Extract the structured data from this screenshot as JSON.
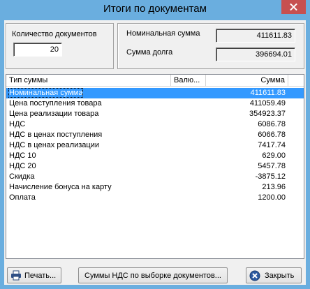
{
  "window": {
    "title": "Итоги по документам"
  },
  "count": {
    "label": "Количество документов",
    "value": "20"
  },
  "sums": {
    "nominal_label": "Номинальная сумма",
    "nominal_value": "411611.83",
    "debt_label": "Сумма долга",
    "debt_value": "396694.01"
  },
  "table": {
    "columns": [
      "Тип суммы",
      "Валю...",
      "Сумма"
    ],
    "rows": [
      {
        "type": "Номинальная сумма",
        "currency": "",
        "amount": "411611.83",
        "selected": true
      },
      {
        "type": "Цена поступления товара",
        "currency": "",
        "amount": "411059.49"
      },
      {
        "type": "Цена реализации товара",
        "currency": "",
        "amount": "354923.37"
      },
      {
        "type": "НДС",
        "currency": "",
        "amount": "6086.78"
      },
      {
        "type": "НДС в ценах поступления",
        "currency": "",
        "amount": "6066.78"
      },
      {
        "type": "НДС в ценах реализации",
        "currency": "",
        "amount": "7417.74"
      },
      {
        "type": "НДС 10",
        "currency": "",
        "amount": "629.00"
      },
      {
        "type": "НДС 20",
        "currency": "",
        "amount": "5457.78"
      },
      {
        "type": "Скидка",
        "currency": "",
        "amount": "-3875.12"
      },
      {
        "type": "Начисление бонуса на карту",
        "currency": "",
        "amount": "213.96"
      },
      {
        "type": "Оплата",
        "currency": "",
        "amount": "1200.00"
      }
    ]
  },
  "buttons": {
    "print": "Печать...",
    "vat": "Суммы НДС по выборке документов...",
    "close": "Закрыть"
  },
  "colors": {
    "titlebar": "#6aaedf",
    "selection": "#3399ff",
    "close": "#c75050"
  }
}
